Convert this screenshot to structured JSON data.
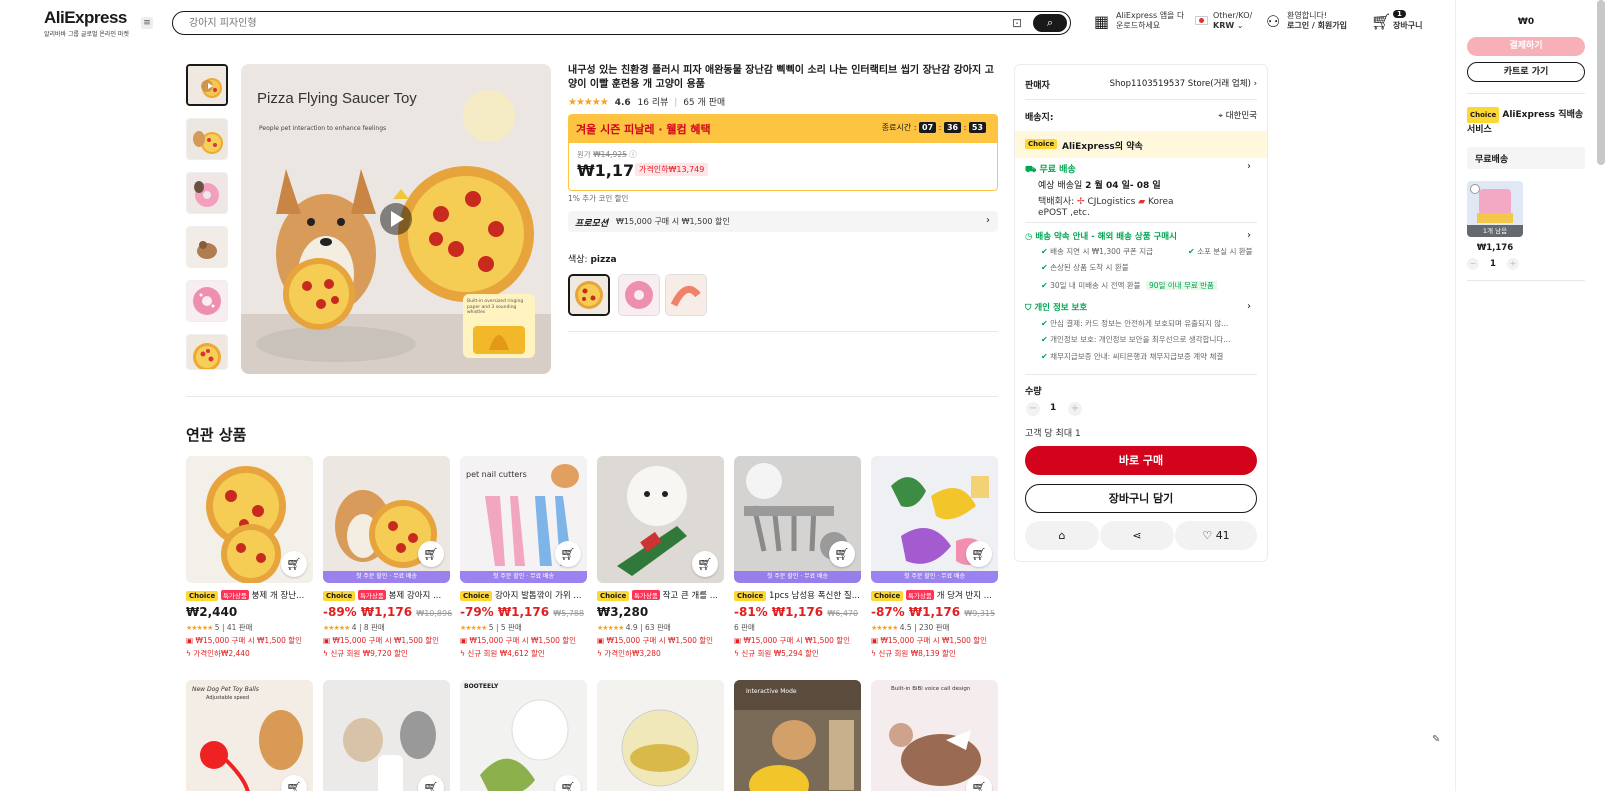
{
  "header": {
    "brand": "AliExpress",
    "brand_sub": "알리바바 그룹 글로벌 온라인 마켓",
    "search_placeholder": "강아지 피자인형",
    "app_line1": "AliExpress 앱을 다",
    "app_line2": "운로드하세요",
    "locale_line1": "Other/KO/",
    "locale_line2": "KRW",
    "user_line1": "환영합니다!",
    "user_line2": "로그인 / 회원가입",
    "cart_count": "1",
    "cart_label": "장바구니"
  },
  "gallery": {
    "main_title": "Pizza Flying Saucer Toy",
    "main_sub": "People pet interaction to enhance feelings",
    "badge_text": "Built-in oversized ringing paper and 3 sounding whistles"
  },
  "product": {
    "title": "내구성 있는 친환경 플러시 피자 애완동물 장난감 삑삑이 소리 나는 인터랙티브 씹기 장난감 강아지 고양이 이빨 훈련용 개 고양이 용품",
    "rating": "4.6",
    "reviews": "16 리뷰",
    "sold": "65 개 판매",
    "sale_title": "겨울 시즌 피날레 · 웰컴 혜택",
    "timer_label": "종료시간 :",
    "timer_h": "07",
    "timer_m": "36",
    "timer_s": "53",
    "orig_label": "원가",
    "orig_price": "₩14,925",
    "price": "₩1,176",
    "discount_tag": "가격인하₩13,749",
    "coupon_note": "1% 추가 코인 할인",
    "promo_label": "프로모션",
    "promo_text": "₩15,000 구매 시 ₩1,500 할인",
    "color_label": "색상:",
    "color_value": "pizza"
  },
  "panel": {
    "seller_label": "판매자",
    "seller_name": "Shop1103519537 Store(거래 업체)",
    "ship_to_label": "배송지:",
    "ship_to_value": "대한민국",
    "choice_badge": "Choice",
    "choice_title": "AliExpress의 약속",
    "free_ship": "무료 배송",
    "eta_prefix": "예상 배송일",
    "eta_value": "2 월 04 일- 08 일",
    "carrier_line1": "택배회사:",
    "carrier_a": "CJLogistics",
    "carrier_b": "Korea",
    "carrier_line2": "ePOST ,etc.",
    "promise_title": "배송 약속 안내 - 해외 배송 상품 구매시",
    "promise_1": "배송 지연 시 ₩1,300 쿠폰 지급",
    "promise_2": "소포 분실 시 환불",
    "promise_3": "손상된 상품 도착 시 환불",
    "promise_4": "30일 내 미배송 시 전액 환불",
    "promise_4_tag": "90일 이내 무료 반품",
    "privacy_title": "개인 정보 보호",
    "privacy_1": "안심 결제: 카드 정보는 안전하게 보호되며 유출되지 않...",
    "privacy_2": "개인정보 보호: 개인정보 보안을 최우선으로 생각합니다...",
    "privacy_3": "채무지급보증 안내: 씨티은행과 채무지급보증 계약 체결",
    "qty_label": "수량",
    "qty_value": "1",
    "limit": "고객 당 최대 1",
    "buy_now": "바로 구매",
    "add_cart": "장바구니 담기",
    "wish_count": "41"
  },
  "related": {
    "title": "연관 상품",
    "cards": [
      {
        "name": "붕제 개 장난...",
        "special": true,
        "price": "₩2,440",
        "discount": "",
        "orig": "",
        "rating": "5",
        "sold": "41 판매",
        "promo1": "₩15,000 구매 시 ₩1,500 할인",
        "promo2": "가격인하₩2,440",
        "strip": ""
      },
      {
        "name": "봉제 강아지 ...",
        "special": true,
        "price": "₩1,176",
        "discount": "-89%",
        "orig": "₩10,896",
        "rating": "4",
        "sold": "8 판매",
        "promo1": "₩15,000 구매 시 ₩1,500 할인",
        "promo2": "신규 회원 ₩9,720 할인",
        "strip": "첫 주문 할인 · 무료 배송"
      },
      {
        "name": "강아지 발톱깎이 가위 ...",
        "special": false,
        "price": "₩1,176",
        "discount": "-79%",
        "orig": "₩5,788",
        "rating": "5",
        "sold": "5 판매",
        "promo1": "₩15,000 구매 시 ₩1,500 할인",
        "promo2": "신규 회원 ₩4,612 할인",
        "strip": "첫 주문 할인 · 무료 배송"
      },
      {
        "name": "작고 큰 개를 ...",
        "special": true,
        "price": "₩3,280",
        "discount": "",
        "orig": "",
        "rating": "4.9",
        "sold": "63 판매",
        "promo1": "₩15,000 구매 시 ₩1,500 할인",
        "promo2": "가격인하₩3,280",
        "strip": ""
      },
      {
        "name": "1pcs 남성용 폭신한 질...",
        "special": false,
        "price": "₩1,176",
        "discount": "-81%",
        "orig": "₩6,470",
        "rating": "",
        "sold": "6 판매",
        "promo1": "₩15,000 구매 시 ₩1,500 할인",
        "promo2": "신규 회원 ₩5,294 할인",
        "strip": "첫 주문 할인 · 무료 배송"
      },
      {
        "name": "개 당겨 반지 ...",
        "special": true,
        "price": "₩1,176",
        "discount": "-87%",
        "orig": "₩9,315",
        "rating": "4.5",
        "sold": "230 판매",
        "promo1": "₩15,000 구매 시 ₩1,500 할인",
        "promo2": "신규 회원 ₩8,139 할인",
        "strip": "첫 주문 할인 · 무료 배송"
      }
    ],
    "badge_choice": "Choice",
    "badge_special": "특가상품",
    "row2_texts": {
      "card1": "New Dog Pet Toy Balls",
      "card1_sub": "Adjustable speed",
      "card3": "BOOTEELY",
      "card5": "Interactive Mode",
      "card6": "Built-in BiBi voice call design"
    },
    "card3_text": "pet nail cutters"
  },
  "sidebar": {
    "total": "₩0",
    "checkout": "결제하기",
    "go_cart": "카트로 가기",
    "choice_badge": "Choice",
    "service_title": "AliExpress 직배송 서비스",
    "free_ship": "무료배송",
    "item_badge": "1개 남음",
    "item_price": "₩1,176",
    "item_qty": "1"
  },
  "colors": {
    "accent_red": "#d3031c",
    "sale_yellow": "#fdc442",
    "choice_yellow": "#fdd835",
    "green": "#00a651"
  }
}
